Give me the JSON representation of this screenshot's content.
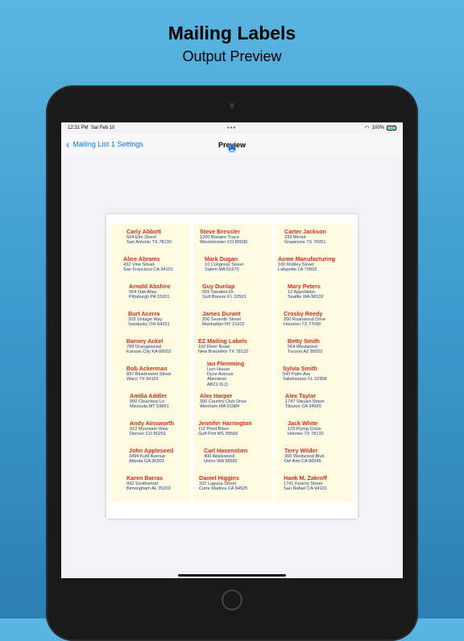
{
  "headline": {
    "title": "Mailing Labels",
    "subtitle": "Output Preview"
  },
  "status": {
    "time": "12:31 PM",
    "date": "Sat Feb 10",
    "battery": "100%"
  },
  "nav": {
    "back_label": "Mailing List 1 Settings",
    "title": "Preview",
    "print_icon": "printer-icon",
    "back_icon": "chevron-left-icon"
  },
  "columns": [
    {
      "labels": [
        {
          "name": "Carly Abbott",
          "lines": [
            "564 Elm Street",
            "San Antonio TX 78130"
          ]
        },
        {
          "name": "Alice Abrams",
          "lines": [
            "432 Vine Street",
            "San Francisco CA 94101"
          ]
        },
        {
          "name": "Arnold Abshire",
          "lines": [
            "564 Oak Alley",
            "Pittsburgh PA 15201"
          ]
        },
        {
          "name": "Burt Acerra",
          "lines": [
            "329 Vintage Way",
            "Sandusky OH 54331"
          ]
        },
        {
          "name": "Barney Ackel",
          "lines": [
            "789 Orangewood",
            "Kansas City KA 66002"
          ]
        },
        {
          "name": "Bob Ackerman",
          "lines": [
            "897 Bluebonnet Street",
            "Waco TX 94101"
          ]
        },
        {
          "name": "Amilia Addler",
          "lines": [
            "900 Clearview Ln",
            "Missoula MT 59801"
          ]
        },
        {
          "name": "Andy Ainsworth",
          "lines": [
            "912 Mountain View",
            "Denver CO 80201"
          ]
        },
        {
          "name": "John Appleseed",
          "lines": [
            "3494 Kuhl Avenue",
            "Atlanta GA 30303"
          ]
        },
        {
          "name": "Karen Barras",
          "lines": [
            "992 Southwood",
            "Birmingham AL 35203"
          ]
        }
      ]
    },
    {
      "labels": [
        {
          "name": "Steve Bressler",
          "lines": [
            "1200 Bonaire Trace",
            "Westminister CO 80030"
          ]
        },
        {
          "name": "Mark Dugan",
          "lines": [
            "10 Congress Street",
            "Salem MA 01970"
          ]
        },
        {
          "name": "Guy Dunlap",
          "lines": [
            "555 Sandest Dr.",
            "Gulf Breeze FL 32563"
          ]
        },
        {
          "name": "James Durant",
          "lines": [
            "200 Seventh Street",
            "Manhattan NY  21102"
          ]
        },
        {
          "name": "EZ Mailing Labels",
          "lines": [
            "100 River Road",
            "New Braunfels TX 78132"
          ]
        },
        {
          "name": "Ian Flemming",
          "lines": [
            "Lion House",
            "Dyce Avenue",
            "Aberdeen",
            "AB21 0LQ"
          ]
        },
        {
          "name": "Alex Harper",
          "lines": [
            "300 Country Club Drive",
            "Wenham MA 01984"
          ]
        },
        {
          "name": "Jennifer Harrington",
          "lines": [
            "112 Pinot Blanc",
            "Gulf Port MS 39503"
          ]
        },
        {
          "name": "Carl Hasenstien",
          "lines": [
            "400 Applewood",
            "Union WA 98592"
          ]
        },
        {
          "name": "Daniel Higgins",
          "lines": [
            "332 Laguna Street",
            "Corte Madrea CA 94925"
          ]
        }
      ]
    },
    {
      "labels": [
        {
          "name": "Carter Jackson",
          "lines": [
            "333 Merlot",
            "Grapevine TX 76051"
          ]
        },
        {
          "name": "Acme Manufacturing",
          "lines": [
            "100 Robley Street",
            "Lafayette LA  70503"
          ]
        },
        {
          "name": "Mary Peters",
          "lines": [
            "12 Appelation",
            "Seattle WA 98102"
          ]
        },
        {
          "name": "Crosby Reedy",
          "lines": [
            "200 Roanwood Drive",
            "Houston TX 77090"
          ]
        },
        {
          "name": "Betty Smith",
          "lines": [
            "564 Westwood",
            "Tucson AZ 85002"
          ]
        },
        {
          "name": "Sylvia Smith",
          "lines": [
            "543 Palm Ave",
            "Tallahassee FL 32308"
          ]
        },
        {
          "name": "Alex Taylor",
          "lines": [
            "1747 Steuart Street",
            "Tiburon CA 94920"
          ]
        },
        {
          "name": "Jack White",
          "lines": [
            "123 Flying Circle",
            "Helotes TX 78133"
          ]
        },
        {
          "name": "Terry Wilder",
          "lines": [
            "300 Westwood Blvd",
            "Del Aire CA 90045"
          ]
        },
        {
          "name": "Hank M. Zakroff",
          "lines": [
            "1741 Kearny Street",
            "San Rafael CA 94101"
          ]
        }
      ]
    }
  ]
}
